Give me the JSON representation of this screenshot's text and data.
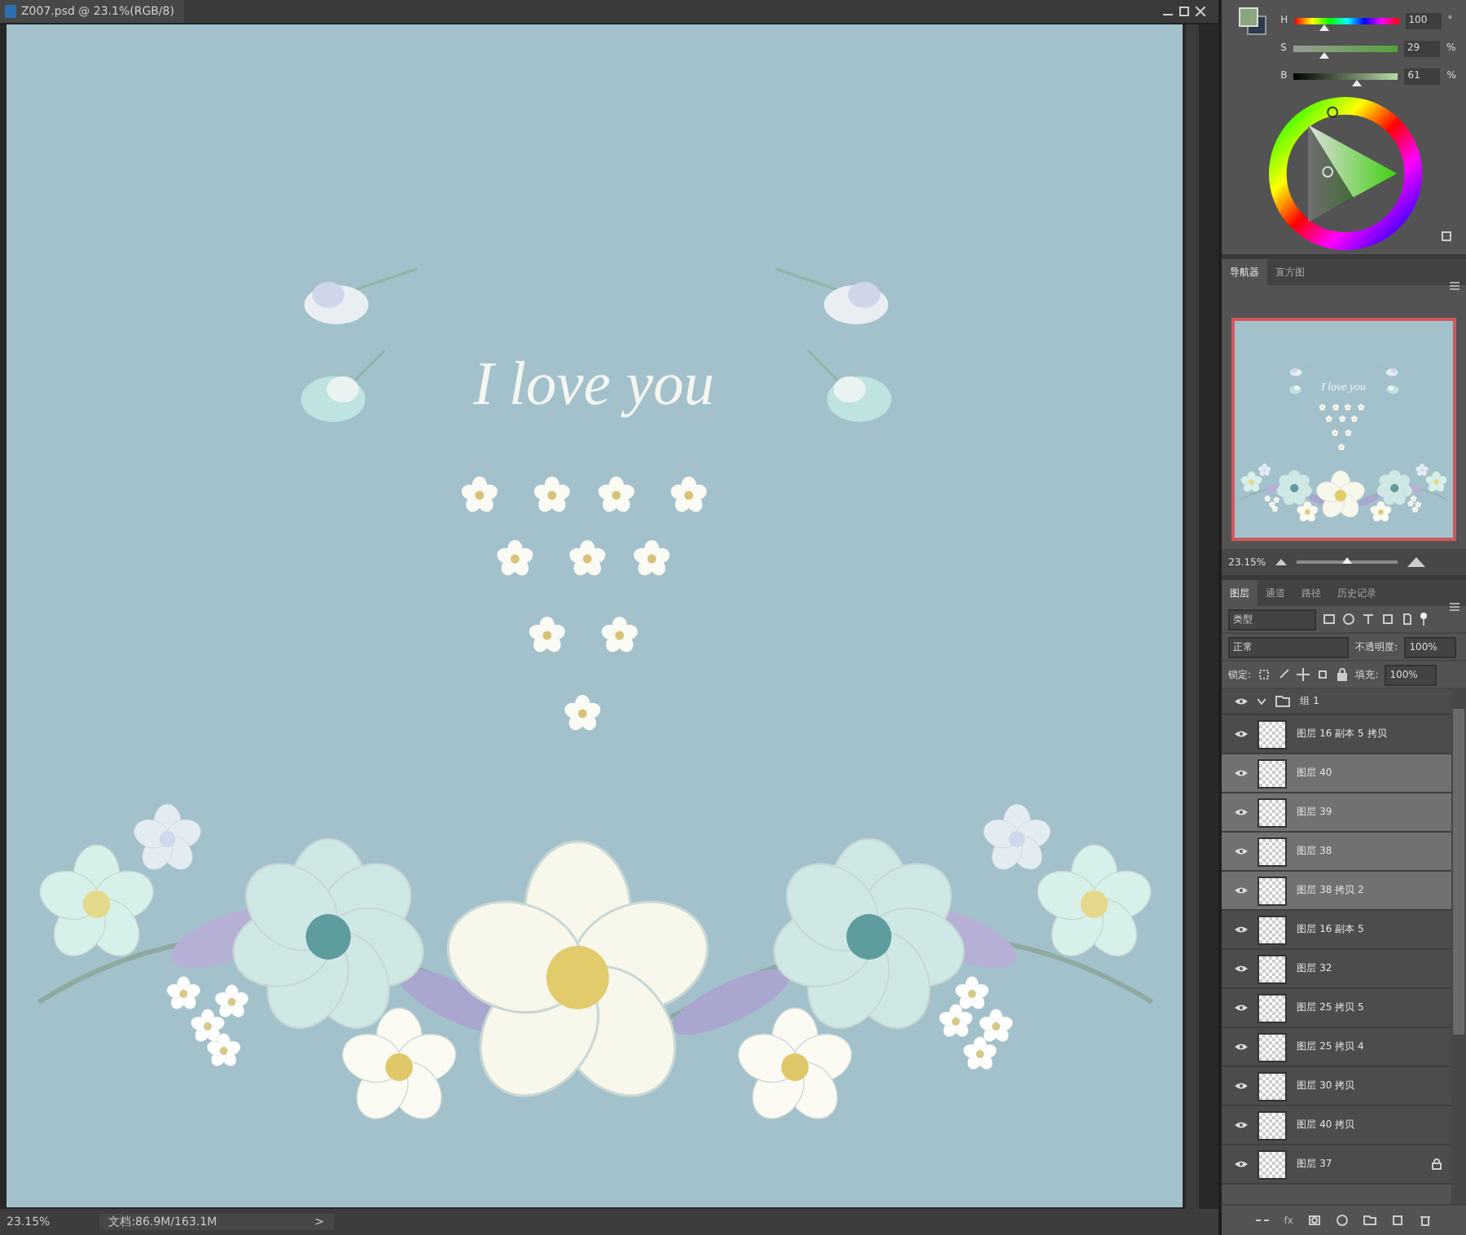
{
  "document": {
    "title": "Z007.psd @ 23.1%(RGB/8)",
    "canvas_text": "I love you",
    "zoom": "23.15%",
    "doc_size": "文档:86.9M/163.1M",
    "status_arrow": ">"
  },
  "color_panel": {
    "sliders": [
      {
        "label": "H",
        "level": 0.28,
        "value": "100",
        "unit": "°",
        "kind": "hue"
      },
      {
        "label": "S",
        "level": 0.29,
        "value": "29",
        "unit": "%",
        "kind": "saturation"
      },
      {
        "label": "B",
        "level": 0.61,
        "value": "61",
        "unit": "%",
        "kind": "brightness"
      }
    ]
  },
  "navigator": {
    "tabs": [
      {
        "label": "导航器",
        "selected": true
      },
      {
        "label": "直方图",
        "selected": false
      }
    ],
    "preview_text": "I love you",
    "zoom": "23.15%",
    "level": 0.5
  },
  "layers": {
    "tabs": [
      {
        "label": "图层",
        "selected": true
      },
      {
        "label": "通道",
        "selected": false
      },
      {
        "label": "路径",
        "selected": false
      },
      {
        "label": "历史记录",
        "selected": false
      }
    ],
    "filter": "类型",
    "blend_mode": "正常",
    "opacity_label": "不透明度:",
    "opacity": "100%",
    "lock_label": "锁定:",
    "fill_label": "填充:",
    "fill": "100%",
    "group": {
      "name": "组 1",
      "expanded": true,
      "visible": true
    },
    "items": [
      {
        "name": "图层 16 副本 5 拷贝",
        "selected": false,
        "visible": true,
        "locked": false
      },
      {
        "name": "图层 40",
        "selected": true,
        "visible": true,
        "locked": false
      },
      {
        "name": "图层 39",
        "selected": true,
        "visible": true,
        "locked": false
      },
      {
        "name": "图层 38",
        "selected": true,
        "visible": true,
        "locked": false
      },
      {
        "name": "图层 38 拷贝 2",
        "selected": true,
        "visible": true,
        "locked": false
      },
      {
        "name": "图层 16 副本 5",
        "selected": false,
        "visible": true,
        "locked": false
      },
      {
        "name": "图层 32",
        "selected": false,
        "visible": true,
        "locked": false
      },
      {
        "name": "图层 25 拷贝 5",
        "selected": false,
        "visible": true,
        "locked": false
      },
      {
        "name": "图层 25 拷贝 4",
        "selected": false,
        "visible": true,
        "locked": false
      },
      {
        "name": "图层 30 拷贝",
        "selected": false,
        "visible": true,
        "locked": false
      },
      {
        "name": "图层 40 拷贝",
        "selected": false,
        "visible": true,
        "locked": false
      },
      {
        "name": "图层 37",
        "selected": false,
        "visible": true,
        "locked": true
      }
    ],
    "toolbar_fx": "fx"
  }
}
